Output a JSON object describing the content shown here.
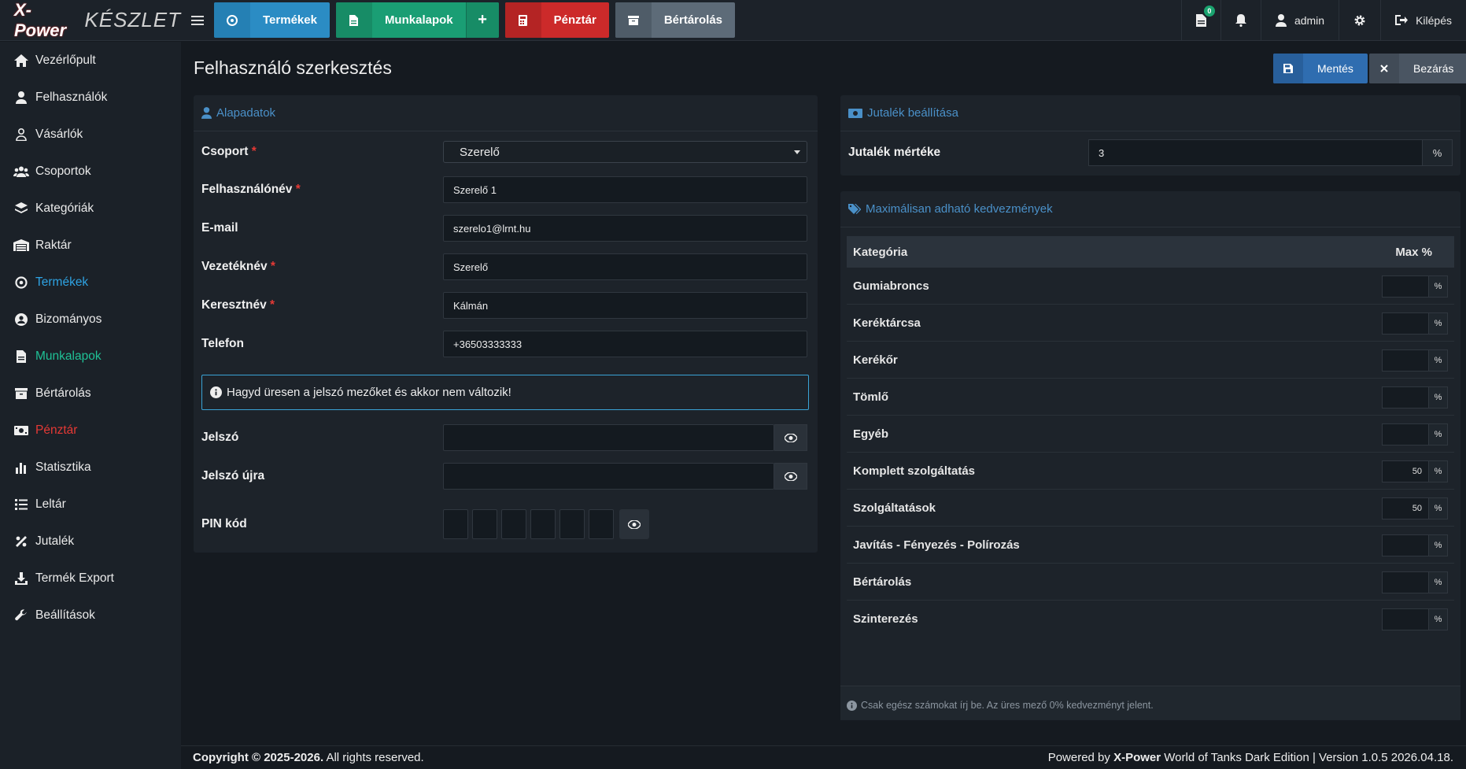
{
  "app": {
    "brand_logo": "X-Power",
    "brand_name": "KÉSZLET"
  },
  "topbar": {
    "buttons": [
      {
        "label": "Termékek",
        "icon": "product-icon"
      },
      {
        "label": "Munkalapok",
        "icon": "document-icon"
      },
      {
        "label": "Pénztár",
        "icon": "calculator-icon"
      },
      {
        "label": "Bértárolás",
        "icon": "archive-icon"
      }
    ],
    "notification_count": "0",
    "user": "admin",
    "logout": "Kilépés"
  },
  "sidebar": {
    "items": [
      {
        "label": "Vezérlőpult",
        "icon": "home-icon"
      },
      {
        "label": "Felhasználók",
        "icon": "user-icon"
      },
      {
        "label": "Vásárlók",
        "icon": "user-outline-icon"
      },
      {
        "label": "Csoportok",
        "icon": "users-icon"
      },
      {
        "label": "Kategóriák",
        "icon": "layers-icon"
      },
      {
        "label": "Raktár",
        "icon": "warehouse-icon"
      },
      {
        "label": "Termékek",
        "icon": "product-icon",
        "state": "active-blue"
      },
      {
        "label": "Bizományos",
        "icon": "user-circle-icon"
      },
      {
        "label": "Munkalapok",
        "icon": "document-icon",
        "state": "active-green"
      },
      {
        "label": "Bértárolás",
        "icon": "archive-icon"
      },
      {
        "label": "Pénztár",
        "icon": "money-icon",
        "state": "active-red"
      },
      {
        "label": "Statisztika",
        "icon": "bar-chart-icon"
      },
      {
        "label": "Leltár",
        "icon": "list-icon"
      },
      {
        "label": "Jutalék",
        "icon": "percent-icon"
      },
      {
        "label": "Termék Export",
        "icon": "download-icon"
      },
      {
        "label": "Beállítások",
        "icon": "wrench-icon"
      }
    ]
  },
  "page": {
    "title": "Felhasználó szerkesztés",
    "save_label": "Mentés",
    "close_label": "Bezárás"
  },
  "basic": {
    "header": "Alapadatok",
    "group_label": "Csoport",
    "group_value": "Szerelő",
    "username_label": "Felhasználónév",
    "username_value": "Szerelő 1",
    "email_label": "E-mail",
    "email_value": "szerelo1@lrnt.hu",
    "lastname_label": "Vezetéknév",
    "lastname_value": "Szerelő",
    "firstname_label": "Keresztnév",
    "firstname_value": "Kálmán",
    "phone_label": "Telefon",
    "phone_value": "+36503333333",
    "info_text": "Hagyd üresen a jelszó mezőket és akkor nem változik!",
    "password_label": "Jelszó",
    "password_value": "",
    "password2_label": "Jelszó újra",
    "password2_value": "",
    "pin_label": "PIN kód",
    "required_mark": "*"
  },
  "commission": {
    "header": "Jutalék beállítása",
    "rate_label": "Jutalék mértéke",
    "rate_value": "3",
    "unit": "%"
  },
  "discounts": {
    "header": "Maximálisan adható kedvezmények",
    "col_category": "Kategória",
    "col_max": "Max %",
    "unit": "%",
    "rows": [
      {
        "category": "Gumiabroncs",
        "value": ""
      },
      {
        "category": "Keréktárcsa",
        "value": ""
      },
      {
        "category": "Kerékőr",
        "value": ""
      },
      {
        "category": "Tömlő",
        "value": ""
      },
      {
        "category": "Egyéb",
        "value": ""
      },
      {
        "category": "Komplett szolgáltatás",
        "value": "50"
      },
      {
        "category": "Szolgáltatások",
        "value": "50"
      },
      {
        "category": "Javítás - Fényezés - Polírozás",
        "value": ""
      },
      {
        "category": "Bértárolás",
        "value": ""
      },
      {
        "category": "Szinterezés",
        "value": ""
      }
    ],
    "note": "Csak egész számokat írj be. Az üres mező 0% kedvezményt jelent."
  },
  "footer": {
    "copyright_bold": "Copyright © 2025-2026.",
    "copyright_rest": "All rights reserved.",
    "powered_prefix": "Powered by",
    "powered_brand": "X-Power",
    "powered_rest": "World of Tanks Dark Edition | Version 1.0.5 2026.04.18."
  },
  "colors": {
    "accent_blue": "#2b8cc4",
    "accent_green": "#1a9e74",
    "accent_red": "#cc2a2a",
    "background": "#151a20"
  }
}
